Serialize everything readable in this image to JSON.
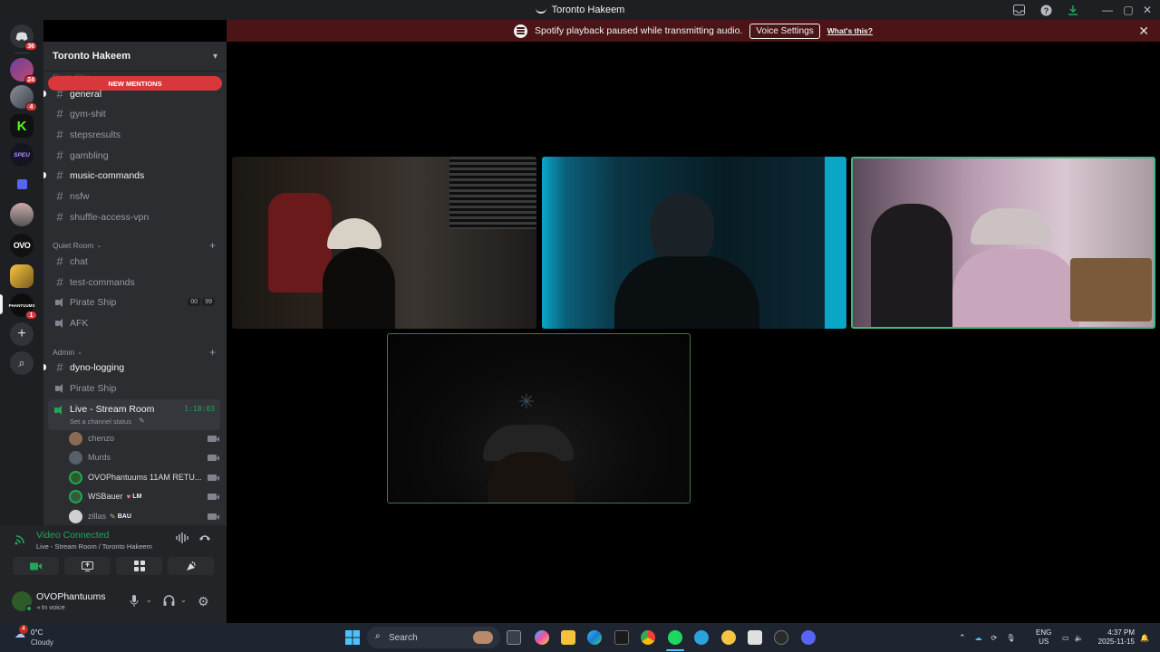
{
  "window": {
    "title": "Toronto Hakeem"
  },
  "notice": {
    "text": "Spotify playback paused while transmitting audio.",
    "voice_settings": "Voice Settings",
    "whats_this": "What's this?",
    "close": "✕"
  },
  "guilds": {
    "home_badge": "36",
    "items": [
      {
        "label": "",
        "badge": "24"
      },
      {
        "label": "",
        "badge": "4"
      },
      {
        "label": "K",
        "badge": ""
      },
      {
        "label": "SPEU",
        "badge": ""
      },
      {
        "label": "",
        "badge": ""
      },
      {
        "label": "",
        "badge": ""
      },
      {
        "label": "OVO",
        "badge": ""
      },
      {
        "label": "",
        "badge": ""
      },
      {
        "label": "PHANTUUMS",
        "badge": "1"
      }
    ],
    "add": "+",
    "discover": "⌕"
  },
  "server": {
    "name": "Toronto Hakeem",
    "new_mentions": "NEW MENTIONS",
    "ghost_category": "Pirate Ship",
    "channels_top": [
      {
        "name": "general",
        "unread": true
      },
      {
        "name": "gym-shit",
        "unread": false
      },
      {
        "name": "stepsresults",
        "unread": false
      },
      {
        "name": "gambling",
        "unread": false
      },
      {
        "name": "music-commands",
        "unread": true
      },
      {
        "name": "nsfw",
        "unread": false
      },
      {
        "name": "shuffle-access-vpn",
        "unread": false
      }
    ],
    "quiet_room": {
      "label": "Quiet Room",
      "channels": [
        "chat",
        "test-commands"
      ],
      "voice": [
        {
          "name": "Pirate Ship",
          "count": "00",
          "limit": "99"
        },
        {
          "name": "AFK"
        }
      ]
    },
    "admin": {
      "label": "Admin",
      "text": "dyno-logging",
      "voice": "Pirate Ship",
      "live": {
        "name": "Live - Stream Room",
        "status": "Set a channel status",
        "timer": "1:18:03"
      },
      "users": [
        {
          "name": "chenzo",
          "badge": "",
          "color": "#8a6a55"
        },
        {
          "name": "Murds",
          "badge": "",
          "color": "#55606a"
        },
        {
          "name": "OVOPhantuums 11AM RETU...",
          "badge": "",
          "color": "#2f5a2a"
        },
        {
          "name": "WSBauer",
          "badge": "LM",
          "color": "#355a3a"
        },
        {
          "name": "zillas",
          "badge": "BAU",
          "color": "#d0d0d0"
        }
      ]
    }
  },
  "voice_panel": {
    "status": "Video Connected",
    "location": "Live - Stream Room / Toronto Hakeem"
  },
  "user": {
    "name": "OVOPhantuums",
    "status": "In voice"
  },
  "taskbar": {
    "weather_badge": "4",
    "temp": "0°C",
    "condition": "Cloudy",
    "search": "Search",
    "lang_top": "ENG",
    "lang_bottom": "US",
    "time": "4:37 PM",
    "date": "2025-11-15"
  }
}
